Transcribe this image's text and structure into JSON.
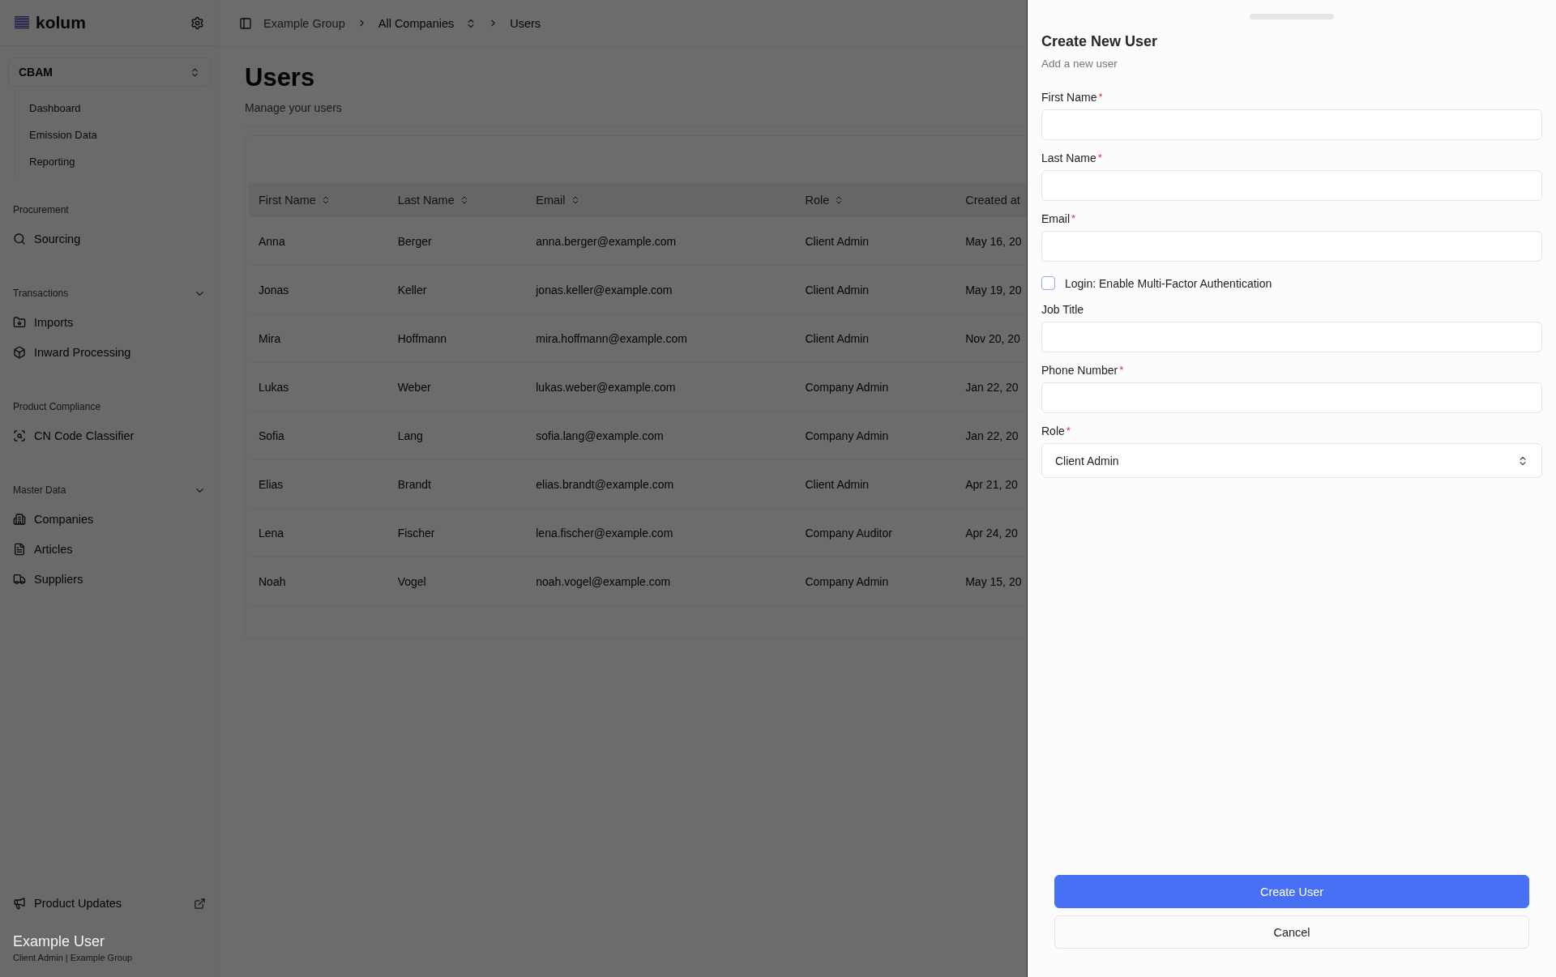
{
  "sidebar": {
    "logo": "kolum",
    "module_select": {
      "value": "CBAM"
    },
    "module_items": [
      {
        "label": "Dashboard"
      },
      {
        "label": "Emission Data"
      },
      {
        "label": "Reporting"
      }
    ],
    "sections": [
      {
        "title": "Procurement",
        "collapsible": false,
        "items": [
          {
            "label": "Sourcing"
          }
        ]
      },
      {
        "title": "Transactions",
        "collapsible": true,
        "items": [
          {
            "label": "Imports"
          },
          {
            "label": "Inward Processing"
          }
        ]
      },
      {
        "title": "Product Compliance",
        "collapsible": false,
        "items": [
          {
            "label": "CN Code Classifier"
          }
        ]
      },
      {
        "title": "Master Data",
        "collapsible": true,
        "items": [
          {
            "label": "Companies"
          },
          {
            "label": "Articles"
          },
          {
            "label": "Suppliers"
          }
        ]
      }
    ],
    "product_updates": "Product Updates",
    "user": {
      "name": "Example User",
      "subtitle": "Client Admin | Example Group"
    }
  },
  "breadcrumbs": [
    {
      "label": "Example Group",
      "switcher": false
    },
    {
      "label": "All Companies",
      "switcher": true
    },
    {
      "label": "Users",
      "switcher": false
    }
  ],
  "page": {
    "title": "Users",
    "subtitle": "Manage your users"
  },
  "table": {
    "columns": [
      {
        "label": "First Name",
        "sortable": true
      },
      {
        "label": "Last Name",
        "sortable": true
      },
      {
        "label": "Email",
        "sortable": true
      },
      {
        "label": "Role",
        "sortable": true
      },
      {
        "label": "Created at"
      }
    ],
    "rows": [
      [
        "Anna",
        "Berger",
        "anna.berger@example.com",
        "Client Admin",
        "May 16, 20"
      ],
      [
        "Jonas",
        "Keller",
        "jonas.keller@example.com",
        "Client Admin",
        "May 19, 20"
      ],
      [
        "Mira",
        "Hoffmann",
        "mira.hoffmann@example.com",
        "Client Admin",
        "Nov 20, 20"
      ],
      [
        "Lukas",
        "Weber",
        "lukas.weber@example.com",
        "Company Admin",
        "Jan 22, 20"
      ],
      [
        "Sofia",
        "Lang",
        "sofia.lang@example.com",
        "Company Admin",
        "Jan 22, 20"
      ],
      [
        "Elias",
        "Brandt",
        "elias.brandt@example.com",
        "Client Admin",
        "Apr 21, 20"
      ],
      [
        "Lena",
        "Fischer",
        "lena.fischer@example.com",
        "Company Auditor",
        "Apr 24, 20"
      ],
      [
        "Noah",
        "Vogel",
        "noah.vogel@example.com",
        "Company Admin",
        "May 15, 20"
      ]
    ]
  },
  "drawer": {
    "title": "Create New User",
    "subtitle": "Add a new user",
    "fields": [
      {
        "kind": "text",
        "label": "First Name",
        "required_mark": "*"
      },
      {
        "kind": "text",
        "label": "Last Name",
        "required_mark": "*"
      },
      {
        "kind": "text",
        "label": "Email",
        "required_mark": "*"
      },
      {
        "kind": "checkbox",
        "label": "Login: Enable Multi-Factor Authentication",
        "checked": false
      },
      {
        "kind": "text",
        "label": "Job Title"
      },
      {
        "kind": "text",
        "label": "Phone Number",
        "required_mark": "*"
      },
      {
        "kind": "select",
        "label": "Role",
        "required_mark": "*",
        "value": "Client Admin"
      }
    ],
    "buttons": [
      {
        "label": "Create User",
        "kind": "primary"
      },
      {
        "label": "Cancel",
        "kind": "secondary"
      }
    ]
  }
}
